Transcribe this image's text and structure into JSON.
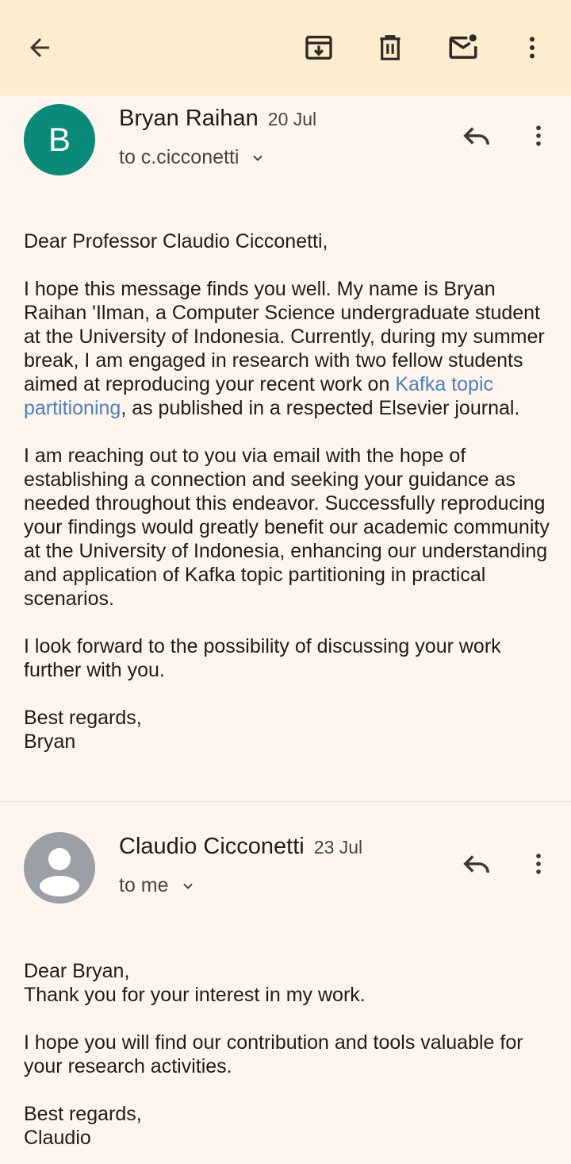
{
  "toolbar": {
    "back_icon": "arrow-left-icon",
    "archive_icon": "archive-icon",
    "delete_icon": "trash-icon",
    "mark_unread_icon": "mail-unread-icon",
    "more_icon": "more-vert-icon"
  },
  "messages": [
    {
      "avatar_letter": "B",
      "avatar_color": "#0a8a78",
      "sender": "Bryan Raihan",
      "date": "20 Jul",
      "recipient": "to c.cicconetti",
      "paragraphs": {
        "p1": "Dear Professor Claudio Cicconetti,",
        "p2_before": "I hope this message finds you well. My name is Bryan Raihan 'Ilman, a Computer Science undergraduate student at the University of Indonesia. Currently, during my summer break, I am engaged in research with two fellow students aimed at reproducing your recent work on ",
        "p2_link": "Kafka topic partitioning",
        "p2_after": ", as published in a respected Elsevier journal.",
        "p3": "I am reaching out to you via email with the hope of establishing a connection and seeking your guidance as needed throughout this endeavor. Successfully reproducing your findings would greatly benefit our academic community at the University of Indonesia, enhancing our understanding and application of Kafka topic partitioning in practical scenarios.",
        "p4": "I look forward to the possibility of discussing your work further with you.",
        "p5_line1": "Best regards,",
        "p5_line2": "Bryan"
      }
    },
    {
      "avatar_color": "#9aa0a6",
      "sender": "Claudio Cicconetti",
      "date": "23 Jul",
      "recipient": "to me",
      "paragraphs": {
        "p1_line1": "Dear Bryan,",
        "p1_line2": "Thank you for your interest in my work.",
        "p2": "I hope you will find our contribution and tools valuable for your research activities.",
        "p3_line1": "Best regards,",
        "p3_line2": "Claudio"
      }
    }
  ]
}
